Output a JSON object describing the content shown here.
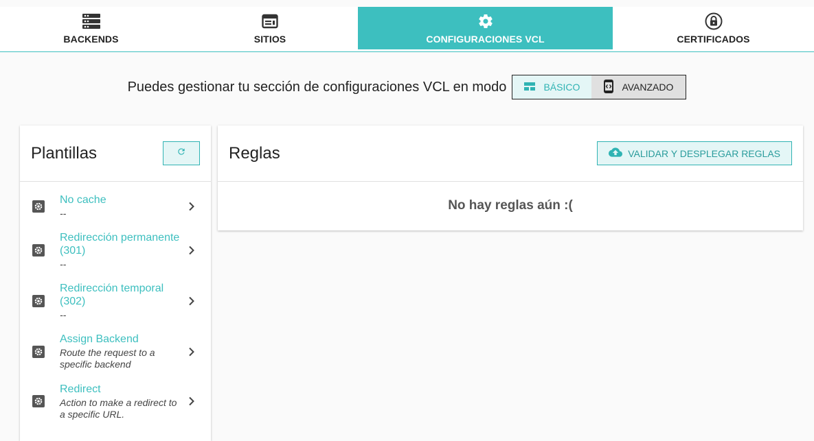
{
  "tabs": [
    {
      "label": "BACKENDS",
      "icon": "server-icon",
      "active": false
    },
    {
      "label": "SITIOS",
      "icon": "web-window-icon",
      "active": false
    },
    {
      "label": "CONFIGURACIONES VCL",
      "icon": "gear-icon",
      "active": true
    },
    {
      "label": "CERTIFICADOS",
      "icon": "lock-icon",
      "active": false
    }
  ],
  "mode": {
    "text": "Puedes gestionar tu sección de configuraciones VCL en modo",
    "basic_label": "BÁSICO",
    "advanced_label": "AVANZADO",
    "selected": "BÁSICO"
  },
  "templates_panel": {
    "title": "Plantillas",
    "items": [
      {
        "name": "No cache",
        "desc": "--"
      },
      {
        "name": "Redirección permanente (301)",
        "desc": "--"
      },
      {
        "name": "Redirección temporal (302)",
        "desc": "--"
      },
      {
        "name": "Assign Backend",
        "desc": "Route the request to a specific backend"
      },
      {
        "name": "Redirect",
        "desc": "Action to make a redirect to a specific URL."
      }
    ]
  },
  "rules_panel": {
    "title": "Reglas",
    "deploy_label": "VALIDAR Y DESPLEGAR REGLAS",
    "empty_text": "No hay reglas aún :("
  },
  "colors": {
    "accent": "#3dbfbf",
    "accent_light": "#e4f6f6",
    "text": "#222222"
  }
}
